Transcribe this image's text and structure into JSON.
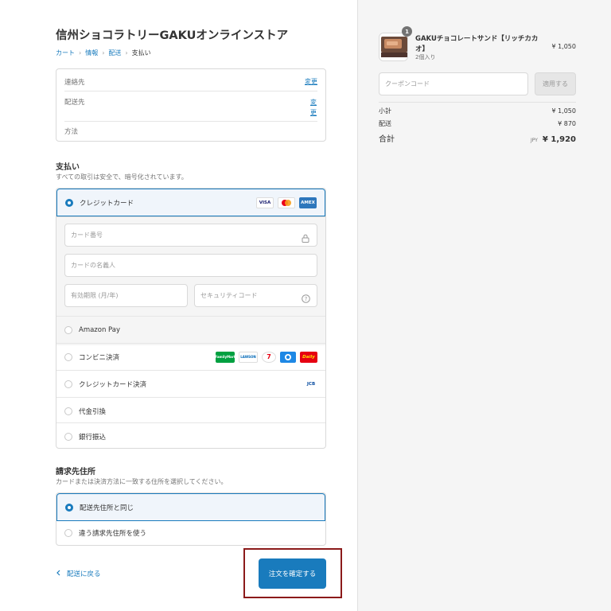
{
  "store": {
    "title": "信州ショコラトリーGAKUオンラインストア"
  },
  "breadcrumb": [
    {
      "label": "カート"
    },
    {
      "label": "情報"
    },
    {
      "label": "配送"
    },
    {
      "label": "支払い"
    }
  ],
  "review": {
    "contact_label": "連絡先",
    "shipping_label": "配送先",
    "method_label": "方法",
    "change_label": "変更"
  },
  "payment": {
    "title": "支払い",
    "subtitle": "すべての取引は安全で、暗号化されています。",
    "credit_card_label": "クレジットカード",
    "card_number_placeholder": "カード番号",
    "card_name_placeholder": "カードの名義人",
    "expiry_placeholder": "有効期限 (月/年)",
    "security_placeholder": "セキュリティコード",
    "amazon_label": "Amazon Pay",
    "conveni_label": "コンビニ決済",
    "credit_card2_label": "クレジットカード決済",
    "cod_label": "代金引換",
    "bank_label": "銀行振込",
    "logos": {
      "visa": "VISA",
      "amex": "AMEX",
      "familymart": "FamilyMart",
      "lawson": "LAWSON",
      "seven": "7",
      "daily": "Daily",
      "jcb": "JCB"
    }
  },
  "billing": {
    "title": "請求先住所",
    "subtitle": "カードまたは決済方法に一致する住所を選択してください。",
    "same_label": "配送先住所と同じ",
    "different_label": "違う請求先住所を使う"
  },
  "footer": {
    "back_label": "配送に戻る",
    "submit_label": "注文を確定する"
  },
  "summary": {
    "product_name": "GAKUチョコレートサンド【リッチカカオ】",
    "product_variant": "2個入り",
    "product_price": "¥ 1,050",
    "quantity": "1",
    "coupon_placeholder": "クーポンコード",
    "apply_label": "適用する",
    "subtotal_label": "小計",
    "subtotal_value": "¥ 1,050",
    "shipping_label": "配送",
    "shipping_value": "¥ 870",
    "total_label": "合計",
    "currency": "JPY",
    "total_value": "¥ 1,920"
  },
  "colors": {
    "accent": "#197bbd",
    "highlight": "#8b1a1a"
  }
}
